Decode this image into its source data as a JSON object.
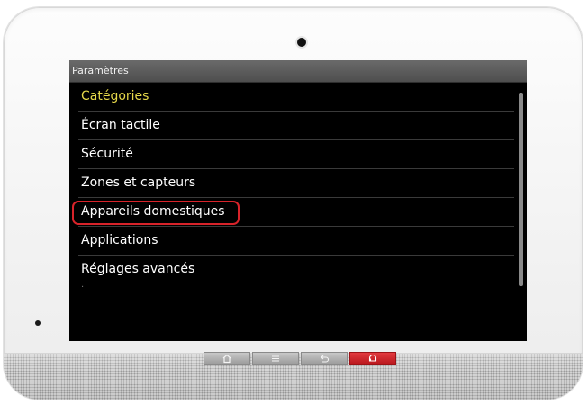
{
  "screen": {
    "title": "Paramètres",
    "category_header": "Catégories",
    "items": [
      {
        "label": "Écran tactile"
      },
      {
        "label": "Sécurité"
      },
      {
        "label": "Zones et capteurs"
      },
      {
        "label": "Appareils domestiques",
        "highlighted": true
      },
      {
        "label": "Applications"
      },
      {
        "label": "Réglages avancés"
      }
    ],
    "partial_item": "·"
  },
  "colors": {
    "header_text": "#e6d84a",
    "highlight_border": "#d8232a",
    "alarm_button": "#c8222a"
  },
  "nav_buttons": [
    {
      "icon": "home-icon"
    },
    {
      "icon": "menu-icon"
    },
    {
      "icon": "back-icon"
    },
    {
      "icon": "alarm-icon"
    }
  ]
}
